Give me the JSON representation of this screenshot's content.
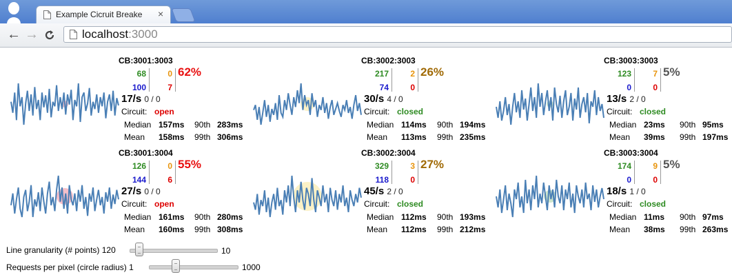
{
  "browser": {
    "tab_title": "Example Cicruit Breake",
    "tab_close": "×",
    "back": "←",
    "forward": "→",
    "reload": "C",
    "url_host": "localhost",
    "url_port": ":3000"
  },
  "labels": {
    "circuit": "Circuit:",
    "median": "Median",
    "mean": "Mean",
    "p90": "90th",
    "p99": "99th"
  },
  "colors": {
    "success": "#2e8b22",
    "short": "#e8940c",
    "timeout": "#1a1acc",
    "fail": "#dd0000",
    "open": "#dd0000",
    "closed": "#2e8b22",
    "spark": "#4a7fb5"
  },
  "circuits": [
    {
      "name": "CB:3001:3003",
      "success": "68",
      "short": "0",
      "timeout": "100",
      "fail": "7",
      "pct": "62%",
      "pct_color": "#e81010",
      "rate": "17/s",
      "rate_sub": "0 / 0",
      "circuit": "open",
      "median": "157ms",
      "p90": "283ms",
      "mean": "158ms",
      "p99": "306ms",
      "bubble_color": "#f4b8c3",
      "bubble_r": "5",
      "series": [
        50,
        38,
        60,
        30,
        70,
        45,
        55,
        25,
        48,
        62,
        40,
        58,
        35,
        66,
        42,
        52,
        30,
        60,
        44,
        57,
        38,
        64,
        33,
        50,
        45,
        68,
        40,
        55,
        42,
        60,
        36,
        58,
        47,
        63,
        30,
        52,
        45,
        70,
        28,
        55,
        60,
        40,
        48,
        65,
        35,
        50,
        42,
        58,
        38,
        55,
        45,
        60,
        32,
        50,
        58,
        40,
        62,
        35,
        54,
        46
      ]
    },
    {
      "name": "CB:3002:3003",
      "success": "217",
      "short": "2",
      "timeout": "74",
      "fail": "0",
      "pct": "26%",
      "pct_color": "#a06a06",
      "rate": "30/s",
      "rate_sub": "4 / 0",
      "circuit": "closed",
      "median": "114ms",
      "p90": "194ms",
      "mean": "113ms",
      "p99": "235ms",
      "bubble_color": "#fbefc0",
      "bubble_r": "10",
      "series": [
        45,
        50,
        35,
        48,
        30,
        42,
        55,
        38,
        50,
        33,
        46,
        40,
        52,
        35,
        60,
        42,
        38,
        55,
        45,
        62,
        50,
        40,
        58,
        48,
        65,
        52,
        72,
        45,
        60,
        50,
        55,
        40,
        62,
        48,
        55,
        38,
        50,
        45,
        58,
        42,
        52,
        36,
        48,
        55,
        40,
        46,
        52,
        44,
        38,
        50,
        45,
        55,
        42,
        48,
        36,
        50,
        60,
        44,
        52,
        40
      ]
    },
    {
      "name": "CB:3003:3003",
      "success": "123",
      "short": "7",
      "timeout": "0",
      "fail": "0",
      "pct": "5%",
      "pct_color": "#555555",
      "rate": "13/s",
      "rate_sub": "2 / 0",
      "circuit": "closed",
      "median": "23ms",
      "p90": "95ms",
      "mean": "39ms",
      "p99": "197ms",
      "bubble_color": "#c8e2c8",
      "bubble_r": "5",
      "series": [
        48,
        40,
        52,
        38,
        45,
        55,
        42,
        50,
        35,
        48,
        58,
        44,
        52,
        40,
        60,
        46,
        54,
        38,
        50,
        62,
        45,
        55,
        40,
        65,
        48,
        58,
        42,
        52,
        60,
        45,
        55,
        38,
        62,
        50,
        44,
        56,
        40,
        52,
        60,
        42,
        48,
        58,
        38,
        54,
        46,
        62,
        40,
        50,
        55,
        44,
        58,
        36,
        52,
        48,
        60,
        42,
        55,
        45,
        50,
        40
      ]
    },
    {
      "name": "CB:3001:3004",
      "success": "126",
      "short": "0",
      "timeout": "144",
      "fail": "6",
      "pct": "55%",
      "pct_color": "#e81010",
      "rate": "27/s",
      "rate_sub": "0 / 0",
      "circuit": "open",
      "median": "161ms",
      "p90": "280ms",
      "mean": "160ms",
      "p99": "308ms",
      "bubble_color": "#f4b8c3",
      "bubble_r": "12",
      "series": [
        45,
        55,
        38,
        50,
        60,
        42,
        35,
        52,
        58,
        40,
        48,
        62,
        35,
        50,
        44,
        56,
        40,
        60,
        48,
        38,
        55,
        65,
        45,
        52,
        40,
        58,
        70,
        48,
        60,
        42,
        55,
        38,
        62,
        50,
        45,
        55,
        40,
        58,
        48,
        62,
        42,
        52,
        36,
        55,
        48,
        60,
        40,
        50,
        58,
        45,
        52,
        38,
        56,
        48,
        60,
        42,
        54,
        46,
        58,
        50
      ]
    },
    {
      "name": "CB:3002:3004",
      "success": "329",
      "short": "3",
      "timeout": "118",
      "fail": "0",
      "pct": "27%",
      "pct_color": "#a06a06",
      "rate": "45/s",
      "rate_sub": "2 / 0",
      "circuit": "closed",
      "median": "112ms",
      "p90": "193ms",
      "mean": "112ms",
      "p99": "212ms",
      "bubble_color": "#fbefc0",
      "bubble_r": "21",
      "series": [
        48,
        42,
        55,
        38,
        50,
        45,
        58,
        40,
        52,
        36,
        48,
        55,
        42,
        60,
        45,
        50,
        38,
        58,
        48,
        62,
        45,
        70,
        52,
        40,
        58,
        48,
        65,
        50,
        42,
        60,
        55,
        45,
        68,
        50,
        40,
        58,
        52,
        45,
        62,
        48,
        55,
        40,
        60,
        50,
        45,
        58,
        42,
        55,
        48,
        62,
        45,
        52,
        40,
        58,
        50,
        45,
        55,
        48,
        60,
        52
      ]
    },
    {
      "name": "CB:3003:3004",
      "success": "174",
      "short": "9",
      "timeout": "0",
      "fail": "0",
      "pct": "5%",
      "pct_color": "#555555",
      "rate": "18/s",
      "rate_sub": "1 / 0",
      "circuit": "closed",
      "median": "11ms",
      "p90": "97ms",
      "mean": "38ms",
      "p99": "263ms",
      "bubble_color": "#c8e2c8",
      "bubble_r": "9",
      "series": [
        50,
        42,
        55,
        38,
        48,
        58,
        40,
        52,
        45,
        35,
        55,
        48,
        60,
        42,
        50,
        38,
        62,
        45,
        55,
        40,
        58,
        48,
        65,
        42,
        52,
        45,
        60,
        50,
        40,
        58,
        48,
        55,
        42,
        62,
        50,
        45,
        58,
        40,
        55,
        48,
        60,
        42,
        52,
        38,
        58,
        50,
        45,
        55,
        42,
        60,
        48,
        52,
        40,
        58,
        46,
        55,
        42,
        50,
        56,
        48
      ]
    }
  ],
  "controls": {
    "granularity_label": "Line granularity (# points)",
    "granularity_min": "120",
    "granularity_max": "10",
    "granularity_level": 0.1,
    "pixel_label": "Requests per pixel (circle radius)",
    "pixel_min": "1",
    "pixel_max": "1000",
    "pixel_level": 0.3
  }
}
